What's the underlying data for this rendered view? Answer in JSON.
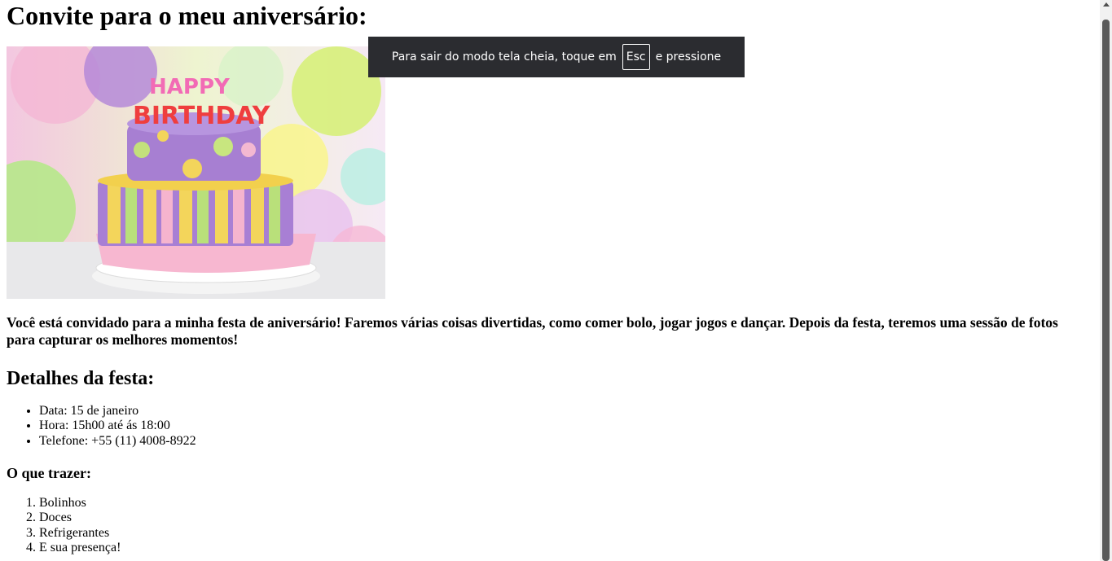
{
  "heading": "Convite para o meu aniversário:",
  "image": {
    "cake_text_top": "HAPPY",
    "cake_text_bottom": "BIRTHDAY"
  },
  "intro": "Você está convidado para a minha festa de aniversário! Faremos várias coisas divertidas, como comer bolo, jogar jogos e dançar. Depois da festa, teremos uma sessão de fotos para capturar os melhores momentos!",
  "details": {
    "title": "Detalhes da festa:",
    "items": [
      "Data: 15 de janeiro",
      "Hora: 15h00 até ás 18:00",
      "Telefone: +55 (11) 4008-8922"
    ]
  },
  "bring": {
    "title": "O que trazer:",
    "items": [
      "Bolinhos",
      "Doces",
      "Refrigerantes",
      "E sua presença!"
    ]
  },
  "fullscreen_toast": {
    "before": "Para sair do modo tela cheia, toque em",
    "key": "Esc",
    "after": "e pressione"
  }
}
